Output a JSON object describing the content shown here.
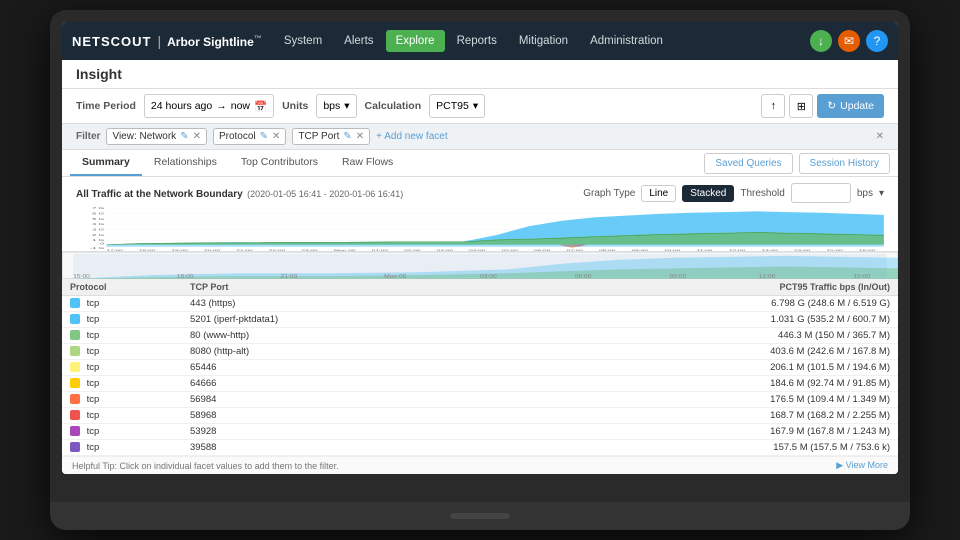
{
  "brand": {
    "netscout": "NETSCOUT",
    "divider": "|",
    "sightline": "Arbor Sightline",
    "tm": "™"
  },
  "nav": {
    "items": [
      {
        "label": "System",
        "active": false
      },
      {
        "label": "Alerts",
        "active": false
      },
      {
        "label": "Explore",
        "active": true
      },
      {
        "label": "Reports",
        "active": false
      },
      {
        "label": "Mitigation",
        "active": false
      },
      {
        "label": "Administration",
        "active": false
      }
    ],
    "icons": [
      {
        "name": "download-icon",
        "symbol": "↓",
        "color": "green"
      },
      {
        "name": "email-icon",
        "symbol": "✉",
        "color": "orange"
      },
      {
        "name": "help-icon",
        "symbol": "?",
        "color": "blue"
      }
    ]
  },
  "page": {
    "title": "Insight"
  },
  "toolbar": {
    "period_label": "Time Period",
    "period_from": "24 hours ago",
    "period_arrow": "→",
    "period_to": "now",
    "units_label": "Units",
    "units_value": "bps",
    "calc_label": "Calculation",
    "calc_value": "PCT95",
    "update_label": "Update"
  },
  "filter": {
    "label": "Filter",
    "tags": [
      {
        "text": "View: Network",
        "editable": true
      },
      {
        "text": "Protocol",
        "editable": true
      },
      {
        "text": "TCP Port",
        "editable": true
      }
    ],
    "add_text": "+ Add new facet"
  },
  "tabs": {
    "items": [
      {
        "label": "Summary",
        "active": true
      },
      {
        "label": "Relationships",
        "active": false
      },
      {
        "label": "Top Contributors",
        "active": false
      },
      {
        "label": "Raw Flows",
        "active": false
      }
    ],
    "right_btns": [
      {
        "label": "Saved Queries"
      },
      {
        "label": "Session History"
      }
    ]
  },
  "chart": {
    "title": "All Traffic at the Network Boundary",
    "date_range": "(2020-01-05 16:41 - 2020-01-06 16:41)",
    "y_unit": "bps (- In / + Out)",
    "graph_type_label": "Graph Type",
    "line_label": "Line",
    "stacked_label": "Stacked",
    "threshold_label": "Threshold",
    "threshold_unit": "bps",
    "y_labels": [
      "7 G",
      "6 G",
      "5 G",
      "4 G",
      "3 G",
      "2 G",
      "1 G",
      "0",
      "-1 G"
    ],
    "x_labels": [
      "17:00",
      "18:00",
      "19:00",
      "20:00",
      "21:00",
      "22:00",
      "23:00",
      "Mon 06",
      "01:00",
      "02:00",
      "03:00",
      "04:00",
      "05:00",
      "06:00",
      "07:00",
      "08:00",
      "09:00",
      "10:00",
      "11:00",
      "12:00",
      "13:00",
      "14:00",
      "15:00",
      "16:00"
    ]
  },
  "mini_chart": {
    "x_labels": [
      "15:00",
      "18:00",
      "21:00",
      "Mon 06",
      "03:00",
      "06:00",
      "09:00",
      "12:00",
      "15:00"
    ]
  },
  "table": {
    "headers": [
      "Protocol",
      "TCP Port",
      "PCT95 Traffic bps (In/Out)"
    ],
    "rows": [
      {
        "color": "#4fc3f7",
        "protocol": "tcp",
        "port": "443 (https)",
        "traffic": "6.798 G (248.6 M / 6.519 G)"
      },
      {
        "color": "#4fc3f7",
        "protocol": "tcp",
        "port": "5201 (iperf-pktdata1)",
        "traffic": "1.031 G (535.2 M / 600.7 M)"
      },
      {
        "color": "#81c784",
        "protocol": "tcp",
        "port": "80 (www-http)",
        "traffic": "446.3 M (150 M / 365.7 M)"
      },
      {
        "color": "#aed581",
        "protocol": "tcp",
        "port": "8080 (http-alt)",
        "traffic": "403.6 M (242.6 M / 167.8 M)"
      },
      {
        "color": "#fff176",
        "protocol": "tcp",
        "port": "65446",
        "traffic": "206.1 M (101.5 M / 194.6 M)"
      },
      {
        "color": "#ffcc02",
        "protocol": "tcp",
        "port": "64666",
        "traffic": "184.6 M (92.74 M / 91.85 M)"
      },
      {
        "color": "#ff7043",
        "protocol": "tcp",
        "port": "56984",
        "traffic": "176.5 M (109.4 M / 1.349 M)"
      },
      {
        "color": "#ef5350",
        "protocol": "tcp",
        "port": "58968",
        "traffic": "168.7 M (168.2 M / 2.255 M)"
      },
      {
        "color": "#ab47bc",
        "protocol": "tcp",
        "port": "53928",
        "traffic": "167.9 M (167.8 M / 1.243 M)"
      },
      {
        "color": "#7e57c2",
        "protocol": "tcp",
        "port": "39588",
        "traffic": "157.5 M (157.5 M / 753.6 k)"
      }
    ]
  },
  "helpful_tip": {
    "text": "Helpful Tip: Click on individual facet values to add them to the filter.",
    "view_more": "▶ View More"
  }
}
